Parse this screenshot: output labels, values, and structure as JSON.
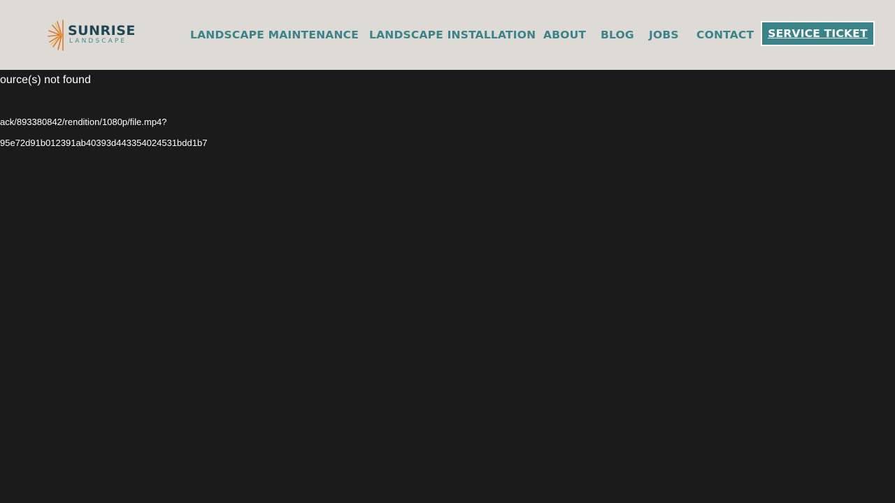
{
  "header": {
    "logo": {
      "word": "SUNRISE",
      "sub": "LANDSCAPE"
    },
    "nav": [
      {
        "label": "LANDSCAPE MAINTENANCE"
      },
      {
        "label": "LANDSCAPE INSTALLATION"
      },
      {
        "label": "ABOUT"
      },
      {
        "label": "BLOG"
      },
      {
        "label": "JOBS"
      },
      {
        "label": "CONTACT"
      }
    ],
    "cta_label": "SERVICE TICKET"
  },
  "media_error": {
    "title": "ource(s) not found",
    "line1": "ack/893380842/rendition/1080p/file.mp4?",
    "line2": "95e72d91b012391ab40393d443354024531bdd1b7"
  },
  "colors": {
    "header_bg": "#dedad5",
    "page_bg": "#1b1b1b",
    "accent": "#3a8388",
    "logo_dark": "#1f4656",
    "sun_orange": "#e0782a"
  }
}
